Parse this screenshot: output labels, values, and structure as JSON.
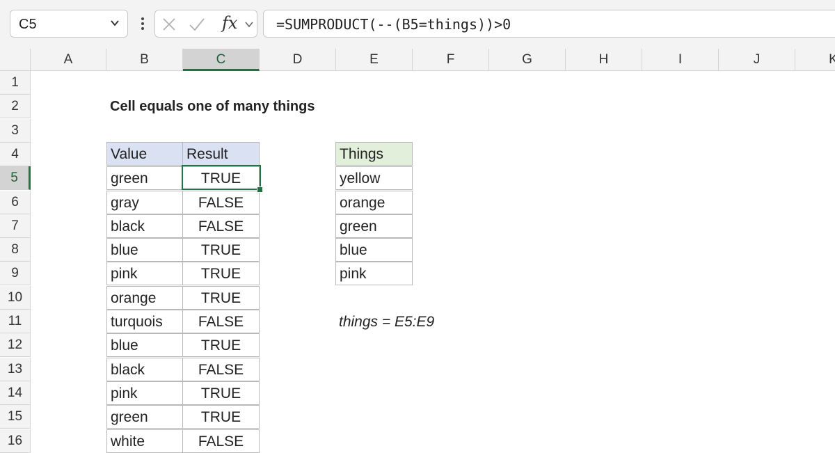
{
  "formula_bar": {
    "name_box": "C5",
    "fx_label": "fx",
    "formula": "=SUMPRODUCT(--(B5=things))>0"
  },
  "columns": [
    "A",
    "B",
    "C",
    "D",
    "E",
    "F",
    "G",
    "H",
    "I",
    "J",
    "K"
  ],
  "rows": [
    "1",
    "2",
    "3",
    "4",
    "5",
    "6",
    "7",
    "8",
    "9",
    "10",
    "11",
    "12",
    "13",
    "14",
    "15",
    "16"
  ],
  "selected": {
    "column": "C",
    "row": "5"
  },
  "sheet": {
    "title": "Cell equals one of many things",
    "table_headers": {
      "value": "Value",
      "result": "Result"
    },
    "table_rows": [
      {
        "value": "green",
        "result": "TRUE"
      },
      {
        "value": "gray",
        "result": "FALSE"
      },
      {
        "value": "black",
        "result": "FALSE"
      },
      {
        "value": "blue",
        "result": "TRUE"
      },
      {
        "value": "pink",
        "result": "TRUE"
      },
      {
        "value": "orange",
        "result": "TRUE"
      },
      {
        "value": "turquois",
        "result": "FALSE"
      },
      {
        "value": "blue",
        "result": "TRUE"
      },
      {
        "value": "black",
        "result": "FALSE"
      },
      {
        "value": "pink",
        "result": "TRUE"
      },
      {
        "value": "green",
        "result": "TRUE"
      },
      {
        "value": "white",
        "result": "FALSE"
      }
    ],
    "things_header": "Things",
    "things": [
      "yellow",
      "orange",
      "green",
      "blue",
      "pink"
    ],
    "named_range_note": "things = E5:E9"
  },
  "colors": {
    "selection": "#217346",
    "header_blue": "#d9e1f2",
    "header_green": "#e2efda"
  }
}
